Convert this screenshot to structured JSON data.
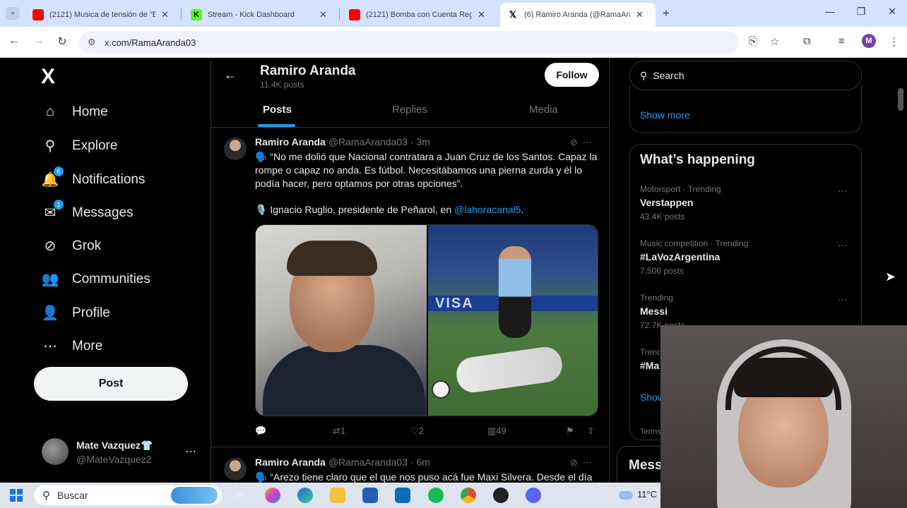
{
  "browser": {
    "tabs": [
      {
        "title": "(2121) Musica de tensión de \"El",
        "favicon_color": "#ff0000",
        "active": false
      },
      {
        "title": "Stream - Kick Dashboard",
        "favicon_color": "#53fc18",
        "active": false
      },
      {
        "title": "(2121) Bomba con Cuenta Regre",
        "favicon_color": "#ff0000",
        "active": false
      },
      {
        "title": "(6) Ramiro Aranda (@RamaAran",
        "favicon_color": "#000000",
        "active": true
      }
    ],
    "new_tab": "+",
    "url": "x.com/RamaAranda03",
    "profile_initial": "M"
  },
  "sidebar": {
    "logo": "X",
    "items": [
      {
        "label": "Home",
        "icon": "home-icon",
        "glyph": "⌂"
      },
      {
        "label": "Explore",
        "icon": "search-icon",
        "glyph": "⚲"
      },
      {
        "label": "Notifications",
        "icon": "bell-icon",
        "glyph": "🔔",
        "badge": "6"
      },
      {
        "label": "Messages",
        "icon": "mail-icon",
        "glyph": "✉",
        "badge": "1"
      },
      {
        "label": "Grok",
        "icon": "grok-icon",
        "glyph": "⊘"
      },
      {
        "label": "Communities",
        "icon": "people-icon",
        "glyph": "👥"
      },
      {
        "label": "Profile",
        "icon": "person-icon",
        "glyph": "👤"
      },
      {
        "label": "More",
        "icon": "more-circle-icon",
        "glyph": "⋯"
      }
    ],
    "post_label": "Post",
    "account": {
      "name": "Mate Vazquez👕",
      "handle": "@MateVazquez2"
    }
  },
  "profile_header": {
    "name": "Ramiro Aranda",
    "posts_count": "11.4K posts",
    "follow_label": "Follow",
    "tabs": [
      "Posts",
      "Replies",
      "Media"
    ]
  },
  "tweets": [
    {
      "author": "Ramiro Aranda",
      "handle": "@RamaAranda03 · 3m",
      "text": "🗣️ “No me dolió que Nacional contratara a Juan Cruz de los Santos. Capaz la rompe o capaz no anda. Es fútbol. Necesitábamos una pierna zurda y él lo podía hacer, pero optamos por otras opciones”.",
      "credit_prefix": "🎙️ Ignacio Ruglio, presidente de Peñarol, en ",
      "credit_link": "@lahoracanal5",
      "credit_suffix": ".",
      "media_text": "VISA",
      "actions": {
        "replies": "",
        "reposts": "1",
        "likes": "2",
        "views": "49"
      }
    },
    {
      "author": "Ramiro Aranda",
      "handle": "@RamaAranda03 · 6m",
      "text": "🗣️ “Arezo tiene claro que el que nos puso acá fue Maxi Silvera. Desde el día"
    }
  ],
  "right": {
    "search_placeholder": "Search",
    "show_more": "Show more",
    "happening_title": "What’s happening",
    "trends": [
      {
        "meta": "Motorsport · Trending",
        "name": "Verstappen",
        "count": "43.4K posts"
      },
      {
        "meta": "Music competition · Trending",
        "name": "#LaVozArgentina",
        "count": "7,506 posts"
      },
      {
        "meta": "Trending",
        "name": "Messi",
        "count": "72.7K posts"
      },
      {
        "meta": "Trend",
        "name": "#Ma",
        "count": ""
      }
    ],
    "show_more_2": "Show",
    "terms": "Terms",
    "messages_drawer": "Mess"
  },
  "taskbar": {
    "search_label": "Buscar",
    "weather": "11°C"
  }
}
